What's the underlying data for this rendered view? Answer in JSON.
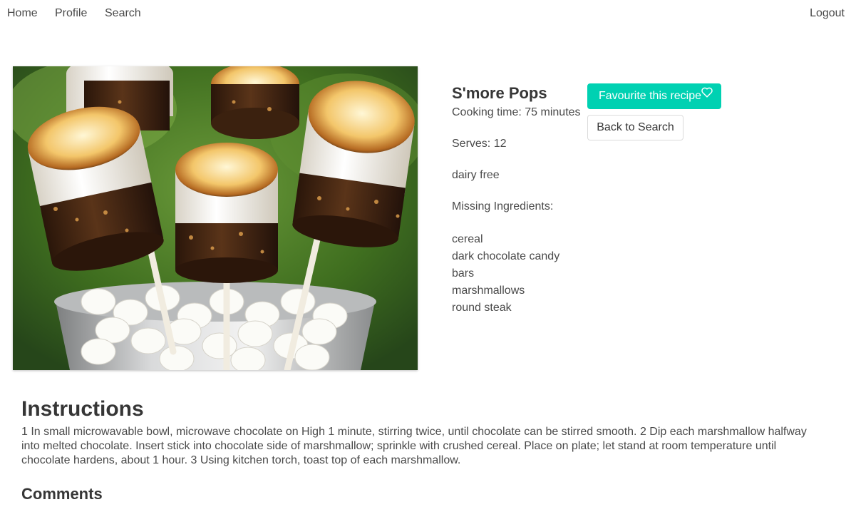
{
  "nav": {
    "home": "Home",
    "profile": "Profile",
    "search": "Search",
    "logout": "Logout"
  },
  "recipe": {
    "title": "S'more Pops",
    "cooking_time": "Cooking time: 75 minutes",
    "serves": "Serves: 12",
    "diet": "dairy free",
    "missing_label": "Missing Ingredients:",
    "missing_ingredients": [
      "cereal",
      "dark chocolate candy bars",
      "marshmallows",
      "round steak"
    ],
    "image_icon": "recipe-photo"
  },
  "actions": {
    "favourite_label": "Favourite this recipe",
    "favourite_icon": "heart-outline-icon",
    "back_label": "Back to Search"
  },
  "instructions": {
    "heading": "Instructions",
    "text": "1 In small microwavable bowl, microwave chocolate on High 1 minute, stirring twice, until chocolate can be stirred smooth. 2 Dip each marshmallow halfway into melted chocolate. Insert stick into chocolate side of marshmallow; sprinkle with crushed cereal. Place on plate; let stand at room temperature until chocolate hardens, about 1 hour. 3 Using kitchen torch, toast top of each marshmallow."
  },
  "comments": {
    "heading": "Comments"
  },
  "colors": {
    "primary": "#00d1b2",
    "text": "#4a4a4a",
    "heading": "#363636",
    "border": "#dbdbdb"
  }
}
